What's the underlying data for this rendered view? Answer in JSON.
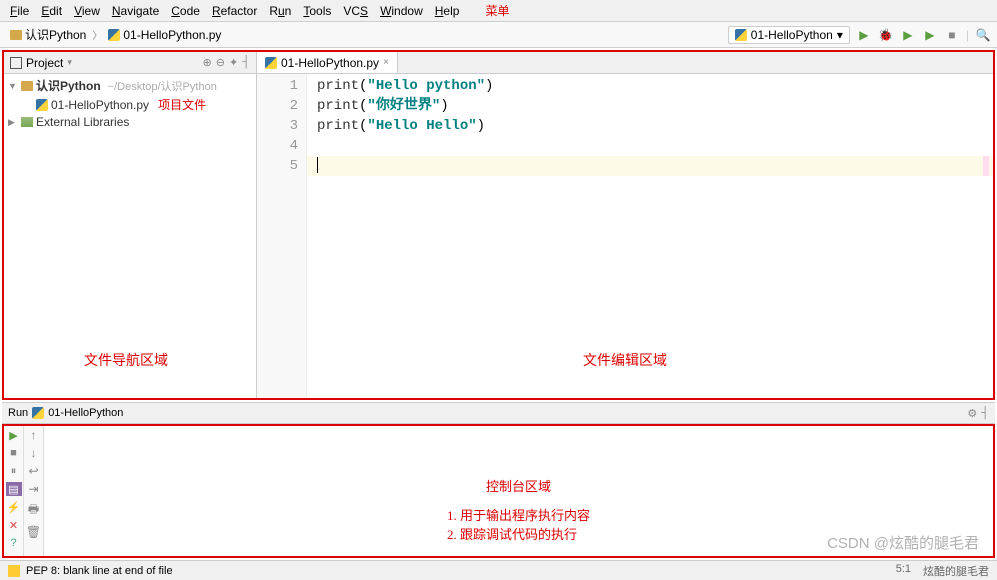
{
  "menu": {
    "items": [
      "File",
      "Edit",
      "View",
      "Navigate",
      "Code",
      "Refactor",
      "Run",
      "Tools",
      "VCS",
      "Window",
      "Help"
    ],
    "annotation": "菜单"
  },
  "breadcrumb": {
    "root": "认识Python",
    "file": "01-HelloPython.py"
  },
  "toolbar": {
    "run_config": "01-HelloPython",
    "config_arrow": "▾"
  },
  "project": {
    "panel_title": "Project",
    "root_name": "认识Python",
    "root_path": "~/Desktop/认识Python",
    "file_name": "01-HelloPython.py",
    "file_annotation": "项目文件",
    "external_libs": "External Libraries",
    "nav_area_label": "文件导航区域"
  },
  "editor": {
    "tab_name": "01-HelloPython.py",
    "lines": [
      "1",
      "2",
      "3",
      "4",
      "5"
    ],
    "code": {
      "l1_fn": "print",
      "l1_p": "(",
      "l1_str": "\"Hello python\"",
      "l1_pc": ")",
      "l2_fn": "print",
      "l2_p": "(",
      "l2_str": "\"你好世界\"",
      "l2_pc": ")",
      "l3_fn": "print",
      "l3_p": "(",
      "l3_str": "\"Hello Hello\"",
      "l3_pc": ")"
    },
    "area_label": "文件编辑区域"
  },
  "run": {
    "title_prefix": "Run",
    "title_name": "01-HelloPython",
    "console_title": "控制台区域",
    "console_desc1": "1. 用于输出程序执行内容",
    "console_desc2": "2. 跟踪调试代码的执行"
  },
  "status": {
    "pep8": "PEP 8: blank line at end of file",
    "pos": "5:1",
    "other": "炫酷的腿毛君"
  },
  "watermark": "CSDN @炫酷的腿毛君"
}
